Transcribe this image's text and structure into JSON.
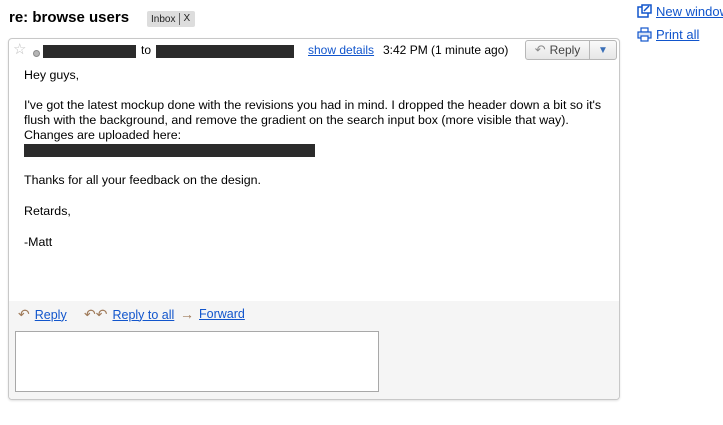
{
  "thread": {
    "subject": "re: browse users",
    "label": "Inbox",
    "label_remove": "X"
  },
  "side_actions": {
    "new_window": "New window",
    "print_all": "Print all"
  },
  "message": {
    "to_word": "to",
    "show_details": "show details",
    "timestamp": "3:42 PM (1 minute ago)",
    "reply_label": "Reply",
    "more_icon": "▼",
    "body": {
      "greeting": "Hey guys,",
      "para1": "I've got the latest mockup done with the revisions you had in mind.  I dropped the header down a bit so it's flush with the background, and remove the gradient on the search input box (more visible that way).",
      "changes_line": "Changes are uploaded here:",
      "thanks": "Thanks for all your feedback on the design.",
      "closing": "Retards,",
      "signature": "-Matt"
    }
  },
  "footer": {
    "reply": "Reply",
    "reply_all": "Reply to all",
    "forward": "Forward"
  },
  "icons": {
    "star": "star-icon",
    "presence": "presence-icon",
    "reply_arrow": "reply-arrow-icon",
    "reply_all_arrow": "reply-all-arrow-icon",
    "forward_arrow": "forward-arrow-icon",
    "new_window": "new-window-icon",
    "print": "print-icon"
  },
  "colors": {
    "link": "#1155cc",
    "redaction": "#2b2b2b",
    "footer_bg": "#f5f5f5"
  }
}
